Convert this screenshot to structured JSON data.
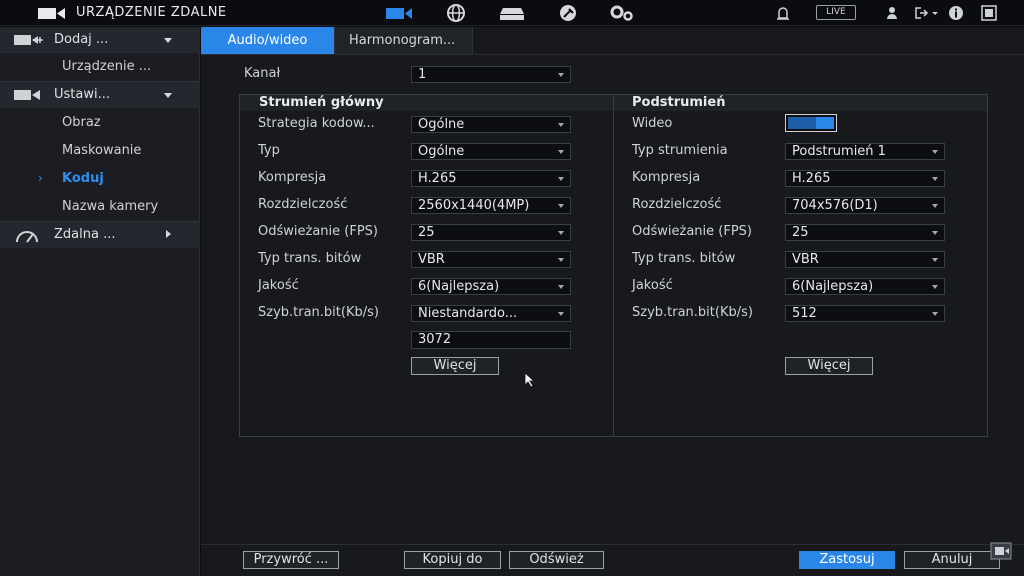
{
  "app": {
    "title": "URZĄDZENIE ZDALNE",
    "live_label": "LIVE"
  },
  "colors": {
    "accent": "#2a86e8",
    "active_text": "#2e8ef0"
  },
  "nav_icons": [
    "camera-icon",
    "globe-icon",
    "storage-icon",
    "maintenance-icon",
    "settings-icon"
  ],
  "sidebar": {
    "groups": [
      {
        "label": "Dodaj ...",
        "items": [
          "Urządzenie ..."
        ]
      },
      {
        "label": "Ustawi...",
        "items": [
          "Obraz",
          "Maskowanie",
          "Koduj",
          "Nazwa kamery"
        ],
        "active": "Koduj"
      },
      {
        "label": "Zdalna ..."
      }
    ]
  },
  "tabs": [
    {
      "label": "Audio/wideo",
      "active": true
    },
    {
      "label": "Harmonogram..."
    }
  ],
  "channel": {
    "label": "Kanał",
    "value": "1"
  },
  "main_stream": {
    "title": "Strumień główny",
    "fields": [
      {
        "label": "Strategia kodow...",
        "value": "Ogólne"
      },
      {
        "label": "Typ",
        "value": "Ogólne"
      },
      {
        "label": "Kompresja",
        "value": "H.265"
      },
      {
        "label": "Rozdzielczość",
        "value": "2560x1440(4MP)"
      },
      {
        "label": "Odświeżanie (FPS)",
        "value": "25"
      },
      {
        "label": "Typ trans. bitów",
        "value": "VBR"
      },
      {
        "label": "Jakość",
        "value": "6(Najlepsza)"
      },
      {
        "label": "Szyb.tran.bit(Kb/s)",
        "value": "Niestandardo..."
      }
    ],
    "custom_bitrate": "3072",
    "more_label": "Więcej"
  },
  "sub_stream": {
    "title": "Podstrumień",
    "video_label": "Wideo",
    "video_enabled": true,
    "fields": [
      {
        "label": "Typ strumienia",
        "value": "Podstrumień 1"
      },
      {
        "label": "Kompresja",
        "value": "H.265"
      },
      {
        "label": "Rozdzielczość",
        "value": "704x576(D1)"
      },
      {
        "label": "Odświeżanie (FPS)",
        "value": "25"
      },
      {
        "label": "Typ trans. bitów",
        "value": "VBR"
      },
      {
        "label": "Jakość",
        "value": "6(Najlepsza)"
      },
      {
        "label": "Szyb.tran.bit(Kb/s)",
        "value": "512"
      }
    ],
    "more_label": "Więcej"
  },
  "footer": {
    "restore": "Przywróć ...",
    "copy": "Kopiuj do",
    "refresh": "Odśwież",
    "apply": "Zastosuj",
    "cancel": "Anuluj"
  }
}
